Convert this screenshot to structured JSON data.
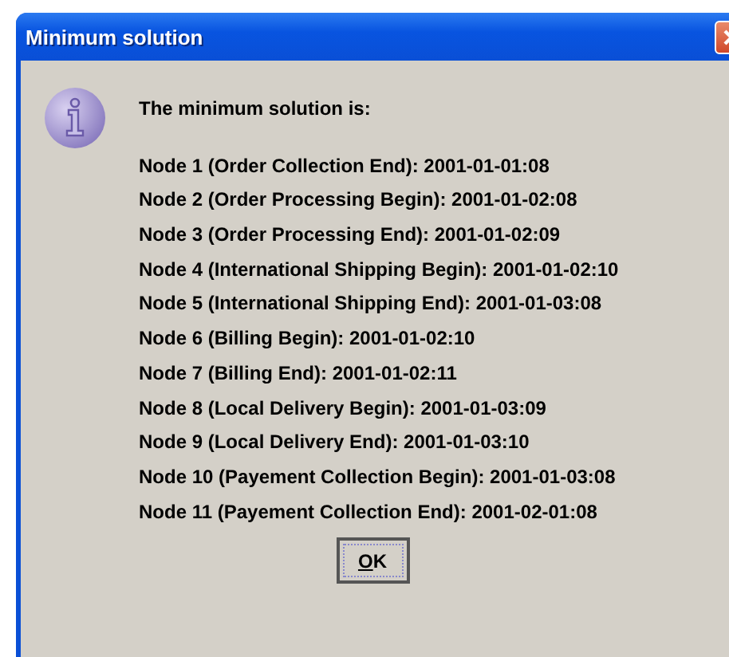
{
  "window": {
    "title": "Minimum solution"
  },
  "message": {
    "heading": "The minimum solution is:",
    "lines": [
      "Node 1 (Order Collection End): 2001-01-01:08",
      "Node 2 (Order Processing Begin): 2001-01-02:08",
      "Node 3 (Order Processing End): 2001-01-02:09",
      "Node 4 (International Shipping Begin): 2001-01-02:10",
      "Node 5 (International Shipping End): 2001-01-03:08",
      "Node 6 (Billing Begin): 2001-01-02:10",
      "Node 7 (Billing End): 2001-01-02:11",
      "Node 8 (Local Delivery Begin): 2001-01-03:09",
      "Node 9 (Local Delivery End): 2001-01-03:10",
      "Node 10 (Payement Collection Begin): 2001-01-03:08",
      "Node 11 (Payement Collection End): 2001-02-01:08"
    ]
  },
  "buttons": [
    "OK"
  ]
}
